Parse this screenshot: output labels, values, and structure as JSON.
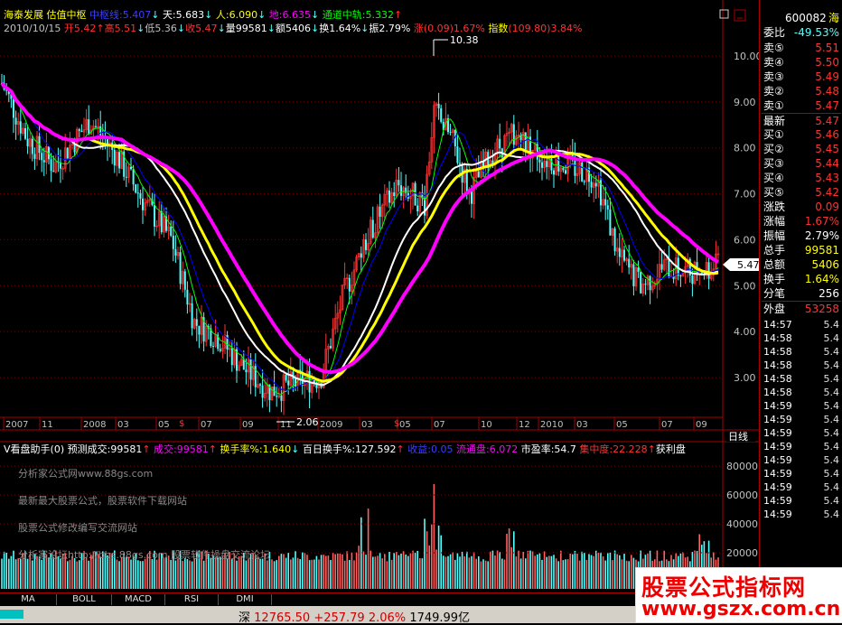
{
  "header": {
    "stock_name": "海泰发展",
    "indicator_name": "估值中枢",
    "mid_label": "中枢线:",
    "mid_value": "5.407",
    "tian_label": "天:",
    "tian_value": "5.683",
    "ren_label": "人:",
    "ren_value": "6.090",
    "di_label": "地:",
    "di_value": "6.635",
    "channel_label": "通道中轨:",
    "channel_value": "5.332",
    "date": "2010/10/15",
    "open_label": "开",
    "open_value": "5.42",
    "high_label": "高",
    "high_value": "5.51",
    "low_label": "低",
    "low_value": "5.36",
    "close_label": "收",
    "close_value": "5.47",
    "vol_label": "量",
    "vol_value": "99581",
    "amt_label": "额",
    "amt_value": "5406",
    "turn_label": "换",
    "turn_value": "1.64%",
    "amp_label": "振",
    "amp_value": "2.79%",
    "chg_label": "涨",
    "chg_value": "(0.09)1.67%",
    "index_label": "指数",
    "index_value": "(109.80)3.84%",
    "max_price": "10.38",
    "min_price": "2.06"
  },
  "price_axis": [
    "10.00",
    "9.00",
    "8.00",
    "7.00",
    "6.00",
    "5.00",
    "4.00",
    "3.00"
  ],
  "current_price_tag": "5.47",
  "time_axis": [
    "2007",
    "11",
    "2008",
    "03",
    "05",
    "07",
    "09",
    "11",
    "2009",
    "03",
    "05",
    "07",
    "10",
    "12",
    "2010",
    "03",
    "05",
    "07",
    "09"
  ],
  "period_label": "日线",
  "volume_header": {
    "title": "V看盘助手(0)",
    "pred_label": "预测成交:",
    "pred_value": "99581",
    "vol_label": "成交:",
    "vol_value": "99581",
    "turn_label": "换手率%:",
    "turn_value": "1.640",
    "turn100_label": "百日换手%:",
    "turn100_value": "127.592",
    "close_label": "收益:",
    "close_value": "0.05",
    "float_label": "流通盘:",
    "float_value": "6.072",
    "pe_label": "市盈率:",
    "pe_value": "54.7",
    "conc_label": "集中度:",
    "conc_value": "22.228",
    "profit_label": "获利盘"
  },
  "volume_axis": [
    "80000",
    "60000",
    "40000",
    "20000"
  ],
  "volume_notes": [
    "分析家公式网www.88gs.com",
    "最新最大股票公式，股票软件下载网站",
    "股票公式修改编写交流网站",
    "分析家论坛http://bbs.88gs.com 股票软件操盘交流论坛"
  ],
  "tabs": [
    "MA",
    "BOLL",
    "MACD",
    "RSI",
    "DMI"
  ],
  "status_bar": {
    "market": "深",
    "index": "12765.50",
    "change": "+257.79",
    "pct": "2.06%",
    "amount": "1749.99亿"
  },
  "sidebar": {
    "code": "600082",
    "name_short": "海",
    "weibi_label": "委比",
    "weibi_value": "-49.53%",
    "asks": [
      {
        "label": "卖⑤",
        "price": "5.51"
      },
      {
        "label": "卖④",
        "price": "5.50"
      },
      {
        "label": "卖③",
        "price": "5.49"
      },
      {
        "label": "卖②",
        "price": "5.48"
      },
      {
        "label": "卖①",
        "price": "5.47"
      }
    ],
    "latest_label": "最新",
    "latest_value": "5.47",
    "bids": [
      {
        "label": "买①",
        "price": "5.46"
      },
      {
        "label": "买②",
        "price": "5.45"
      },
      {
        "label": "买③",
        "price": "5.44"
      },
      {
        "label": "买④",
        "price": "5.43"
      },
      {
        "label": "买⑤",
        "price": "5.42"
      }
    ],
    "stats": [
      {
        "label": "涨跌",
        "value": "0.09"
      },
      {
        "label": "涨幅",
        "value": "1.67%"
      },
      {
        "label": "振幅",
        "value": "2.79%"
      },
      {
        "label": "总手",
        "value": "99581"
      },
      {
        "label": "总额",
        "value": "5406"
      },
      {
        "label": "换手",
        "value": "1.64%"
      },
      {
        "label": "分笔",
        "value": "256"
      }
    ],
    "outer_label": "外盘",
    "outer_value": "53258",
    "ticks": [
      {
        "time": "14:57",
        "price": "5.4"
      },
      {
        "time": "14:58",
        "price": "5.4"
      },
      {
        "time": "14:58",
        "price": "5.4"
      },
      {
        "time": "14:58",
        "price": "5.4"
      },
      {
        "time": "14:58",
        "price": "5.4"
      },
      {
        "time": "14:58",
        "price": "5.4"
      },
      {
        "time": "14:59",
        "price": "5.4"
      },
      {
        "time": "14:59",
        "price": "5.4"
      },
      {
        "time": "14:59",
        "price": "5.4"
      },
      {
        "time": "14:59",
        "price": "5.4"
      },
      {
        "time": "14:59",
        "price": "5.4"
      },
      {
        "time": "14:59",
        "price": "5.4"
      },
      {
        "time": "14:59",
        "price": "5.4"
      },
      {
        "time": "14:59",
        "price": "5.4"
      },
      {
        "time": "14:59",
        "price": "5.4"
      }
    ]
  },
  "watermark": {
    "line1": "股票公式指标网",
    "line2": "www.gszx.com.cn"
  },
  "colors": {
    "up": "#ff3232",
    "down": "#54ffff",
    "tian": "#ffffff",
    "ren": "#ffff00",
    "di": "#ff00ff",
    "mid": "#0000ff",
    "channel": "#00ff00"
  }
}
